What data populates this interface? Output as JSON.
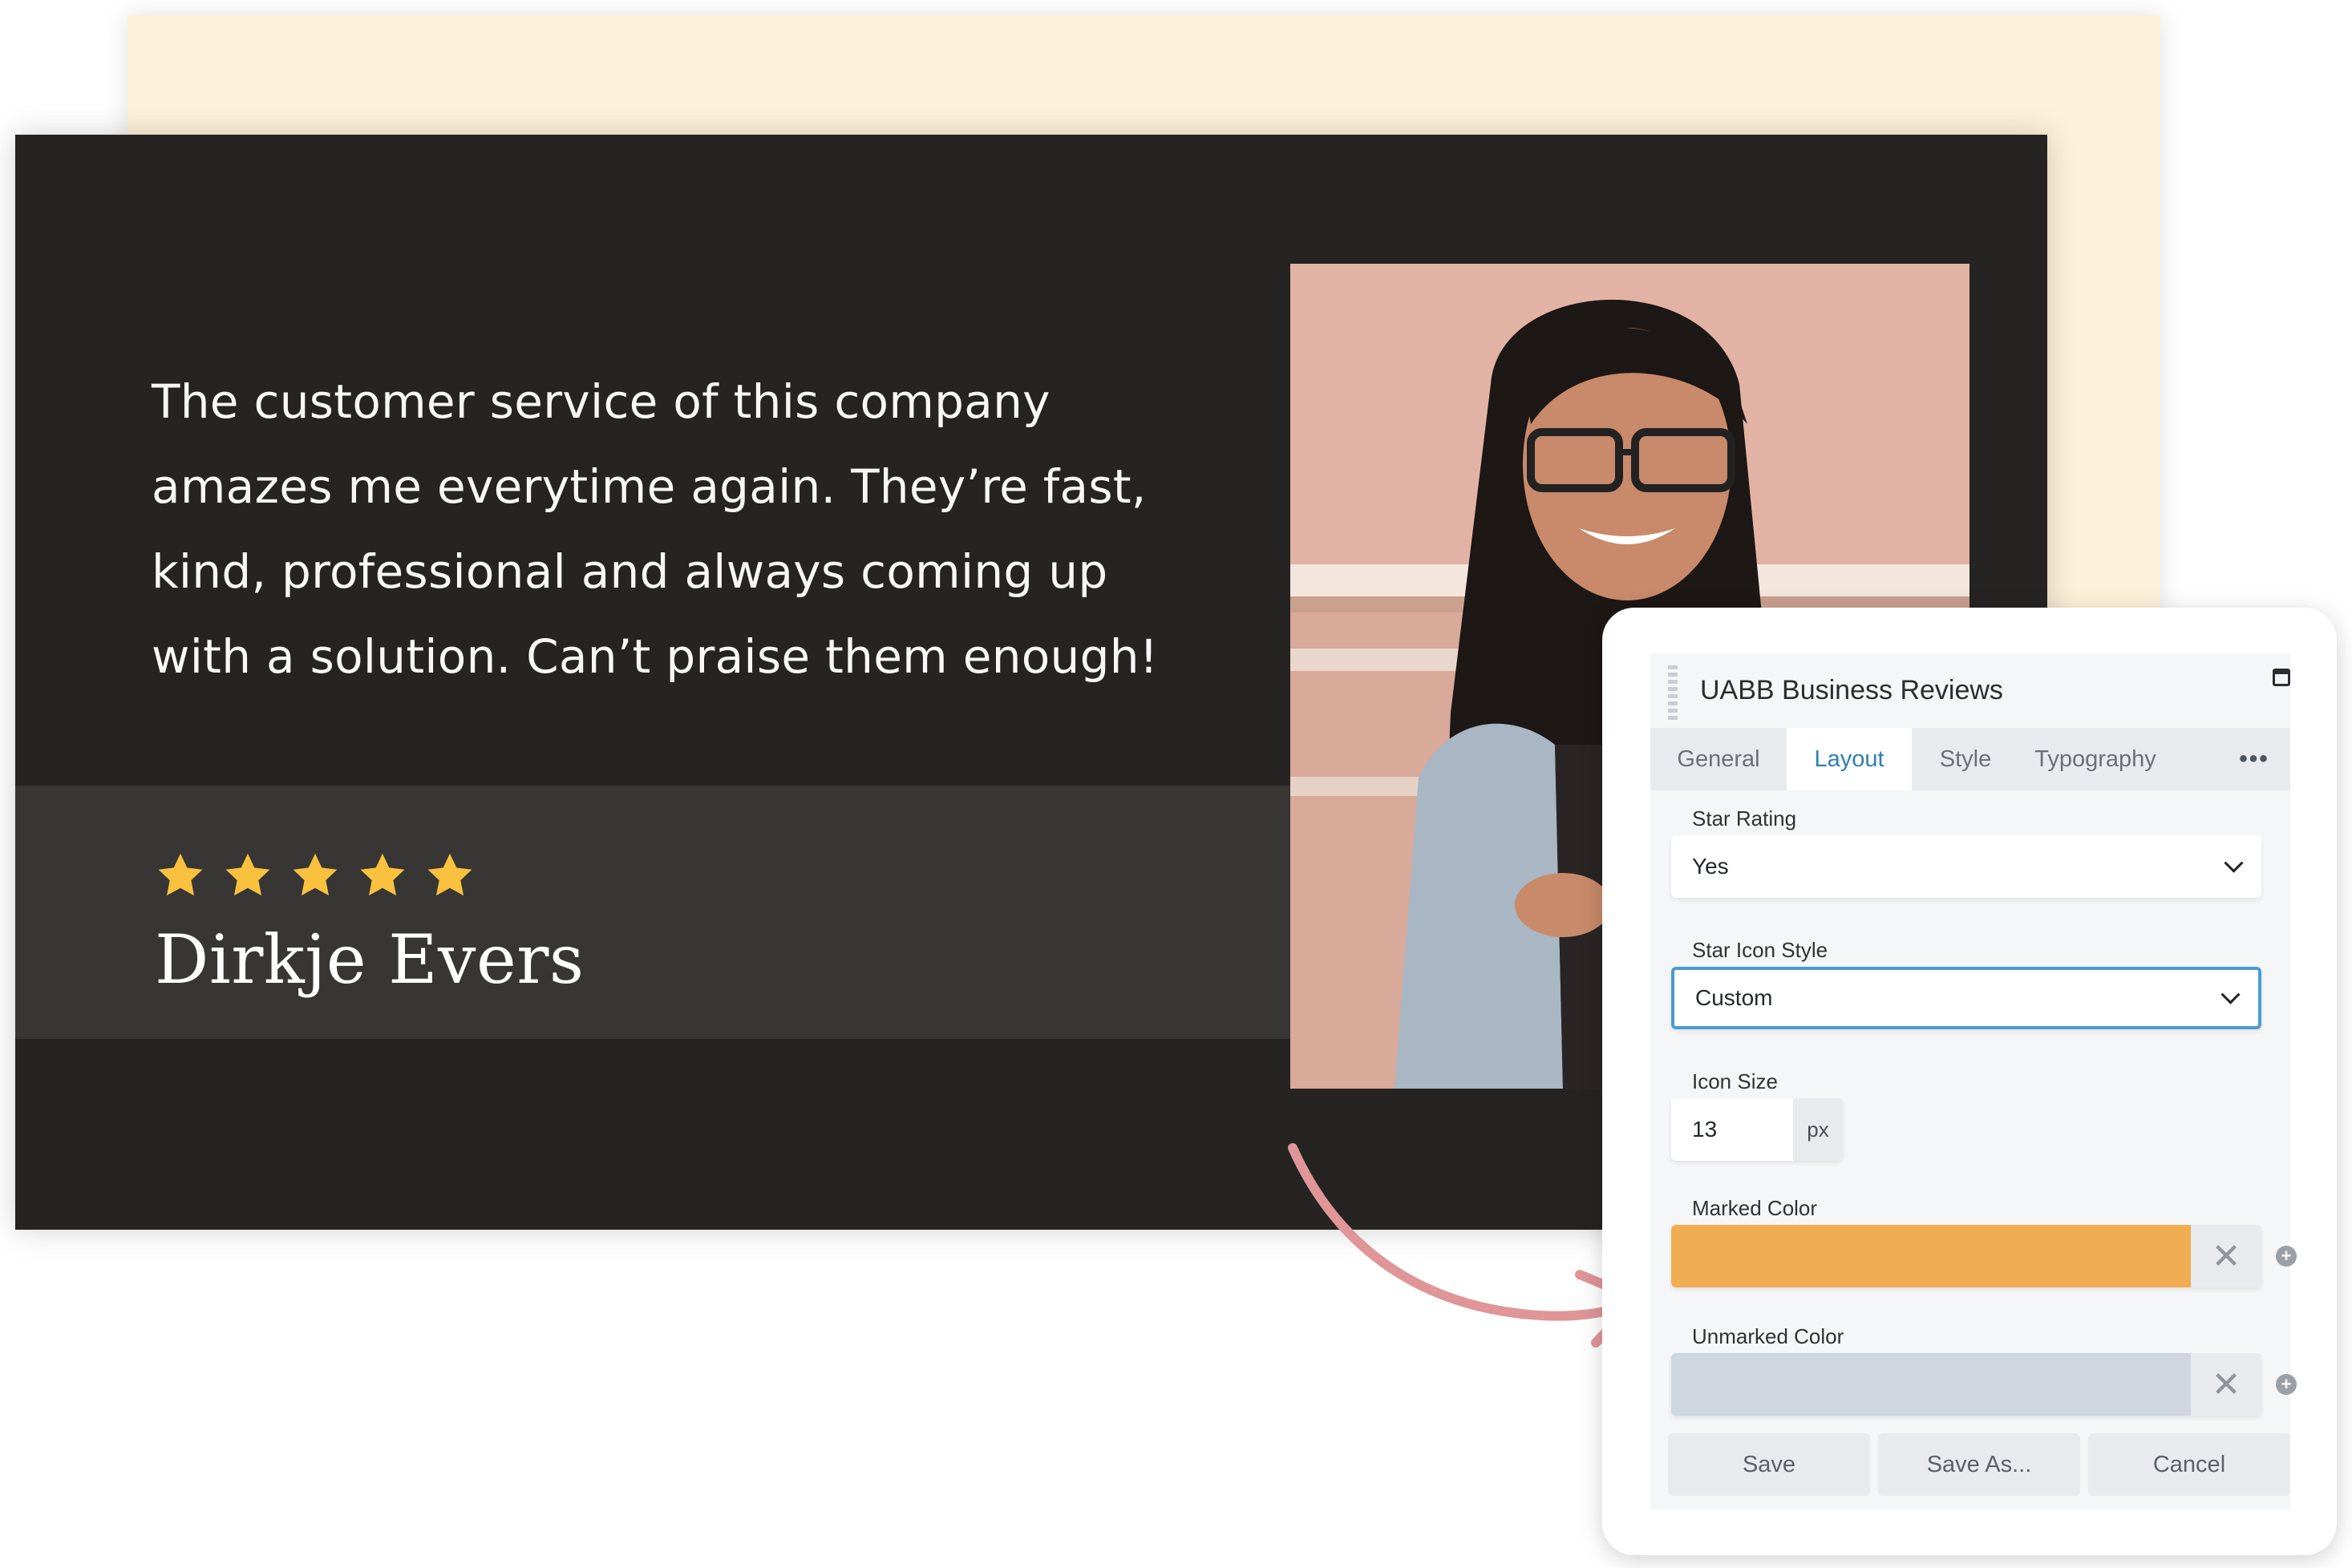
{
  "testimonial": {
    "quote_lines": [
      "The customer service of this company",
      "amazes me everytime again. They’re fast,",
      "kind, professional and always coming up",
      "with a solution. Can’t praise them enough!"
    ],
    "rating": 5,
    "rating_max": 5,
    "reviewer_name": "Dirkje Evers",
    "star_color": "#f9c13d"
  },
  "panel": {
    "title": "UABB Business Reviews",
    "tabs": [
      {
        "label": "General",
        "active": false
      },
      {
        "label": "Layout",
        "active": true
      },
      {
        "label": "Style",
        "active": false
      },
      {
        "label": "Typography",
        "active": false
      }
    ],
    "more_tabs_label": "•••",
    "fields": {
      "star_rating": {
        "label": "Star Rating",
        "value": "Yes"
      },
      "star_icon_style": {
        "label": "Star Icon Style",
        "value": "Custom"
      },
      "icon_size": {
        "label": "Icon Size",
        "value": "13",
        "unit": "px"
      },
      "marked_color": {
        "label": "Marked Color",
        "value": "#f1ad52",
        "clear": "✕"
      },
      "unmarked_color": {
        "label": "Unmarked Color",
        "value": "#d0d6dd",
        "clear": "✕"
      }
    },
    "buttons": {
      "save": "Save",
      "save_as": "Save As...",
      "cancel": "Cancel"
    }
  },
  "colors": {
    "accent": "#2e7fb5",
    "annotation_arrow": "#e09597"
  }
}
